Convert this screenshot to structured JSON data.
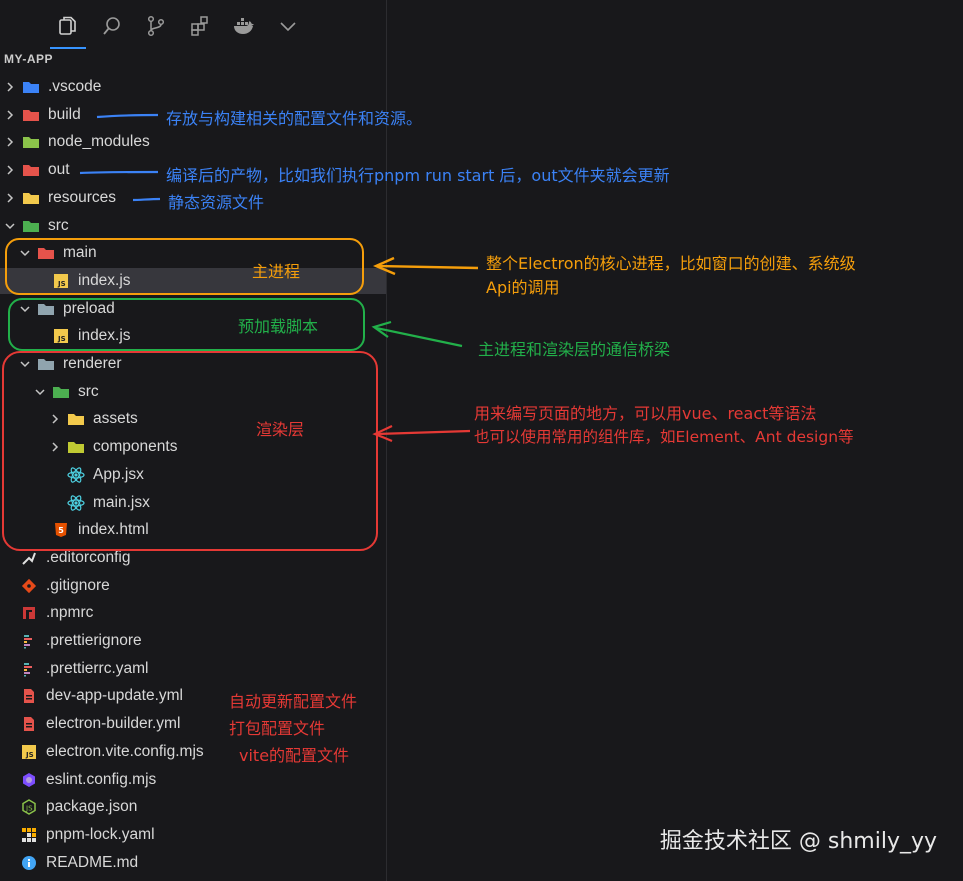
{
  "explorer": {
    "title": "MY-APP"
  },
  "activity_bar": [
    {
      "icon": "files-icon",
      "active": true
    },
    {
      "icon": "search-icon",
      "active": false
    },
    {
      "icon": "source-control-icon",
      "active": false
    },
    {
      "icon": "extensions-icon",
      "active": false
    },
    {
      "icon": "docker-icon",
      "active": false
    },
    {
      "icon": "chevron-down-icon",
      "active": false
    }
  ],
  "tree": [
    {
      "label": ".vscode",
      "type": "folder",
      "depth": 0,
      "chevron": "right",
      "icon_color": "#3b82f6"
    },
    {
      "label": "build",
      "type": "folder",
      "depth": 0,
      "chevron": "right",
      "icon_color": "#e5534b"
    },
    {
      "label": "node_modules",
      "type": "folder",
      "depth": 0,
      "chevron": "right",
      "icon_color": "#8bc34a"
    },
    {
      "label": "out",
      "type": "folder",
      "depth": 0,
      "chevron": "right",
      "icon_color": "#e5534b"
    },
    {
      "label": "resources",
      "type": "folder",
      "depth": 0,
      "chevron": "right",
      "icon_color": "#f2c94c"
    },
    {
      "label": "src",
      "type": "folder-open",
      "depth": 0,
      "chevron": "down",
      "icon_color": "#4caf50"
    },
    {
      "label": "main",
      "type": "folder-open",
      "depth": 1,
      "chevron": "down",
      "icon_color": "#e5534b"
    },
    {
      "label": "index.js",
      "type": "js",
      "depth": 2,
      "chevron": "none",
      "selected": true
    },
    {
      "label": "preload",
      "type": "folder-open",
      "depth": 1,
      "chevron": "down",
      "icon_color": "#90a4ae"
    },
    {
      "label": "index.js",
      "type": "js",
      "depth": 2,
      "chevron": "none"
    },
    {
      "label": "renderer",
      "type": "folder-open",
      "depth": 1,
      "chevron": "down",
      "icon_color": "#90a4ae"
    },
    {
      "label": "src",
      "type": "folder-open",
      "depth": 2,
      "chevron": "down",
      "icon_color": "#4caf50"
    },
    {
      "label": "assets",
      "type": "folder",
      "depth": 3,
      "chevron": "right",
      "icon_color": "#f2c94c"
    },
    {
      "label": "components",
      "type": "folder",
      "depth": 3,
      "chevron": "right",
      "icon_color": "#c0ca33"
    },
    {
      "label": "App.jsx",
      "type": "react",
      "depth": 3,
      "chevron": "none"
    },
    {
      "label": "main.jsx",
      "type": "react",
      "depth": 3,
      "chevron": "none"
    },
    {
      "label": "index.html",
      "type": "html",
      "depth": 2,
      "chevron": "none"
    },
    {
      "label": ".editorconfig",
      "type": "editorconfig",
      "depth": 0,
      "chevron": "none"
    },
    {
      "label": ".gitignore",
      "type": "git",
      "depth": 0,
      "chevron": "none"
    },
    {
      "label": ".npmrc",
      "type": "npm",
      "depth": 0,
      "chevron": "none"
    },
    {
      "label": ".prettierignore",
      "type": "prettier",
      "depth": 0,
      "chevron": "none"
    },
    {
      "label": ".prettierrc.yaml",
      "type": "prettier",
      "depth": 0,
      "chevron": "none"
    },
    {
      "label": "dev-app-update.yml",
      "type": "yaml",
      "depth": 0,
      "chevron": "none"
    },
    {
      "label": "electron-builder.yml",
      "type": "yaml",
      "depth": 0,
      "chevron": "none"
    },
    {
      "label": "electron.vite.config.mjs",
      "type": "js",
      "depth": 0,
      "chevron": "none"
    },
    {
      "label": "eslint.config.mjs",
      "type": "eslint",
      "depth": 0,
      "chevron": "none"
    },
    {
      "label": "package.json",
      "type": "nodejs",
      "depth": 0,
      "chevron": "none"
    },
    {
      "label": "pnpm-lock.yaml",
      "type": "pnpm",
      "depth": 0,
      "chevron": "none"
    },
    {
      "label": "README.md",
      "type": "info",
      "depth": 0,
      "chevron": "none"
    }
  ],
  "annotations": {
    "build": "存放与构建相关的配置文件和资源。",
    "out": "编译后的产物，比如我们执行pnpm run start 后，out文件夹就会更新",
    "resources": "静态资源文件",
    "main_box": "主进程",
    "main_desc_1": "整个Electron的核心进程，比如窗口的创建、系统级",
    "main_desc_2": "Api的调用",
    "preload_box": "预加载脚本",
    "preload_desc": "主进程和渲染层的通信桥梁",
    "renderer_box": "渲染层",
    "renderer_desc_1": "用来编写页面的地方，可以用vue、react等语法",
    "renderer_desc_2": "也可以使用常用的组件库，如Element、Ant design等",
    "dev_app_update": "自动更新配置文件",
    "electron_builder": "打包配置文件",
    "electron_vite": "vite的配置文件"
  },
  "colors": {
    "blue": "#3b82f6",
    "orange": "#f59e0b",
    "green": "#22b04a",
    "red": "#e53935"
  },
  "watermark": "掘金技术社区 @ shmily_yy"
}
